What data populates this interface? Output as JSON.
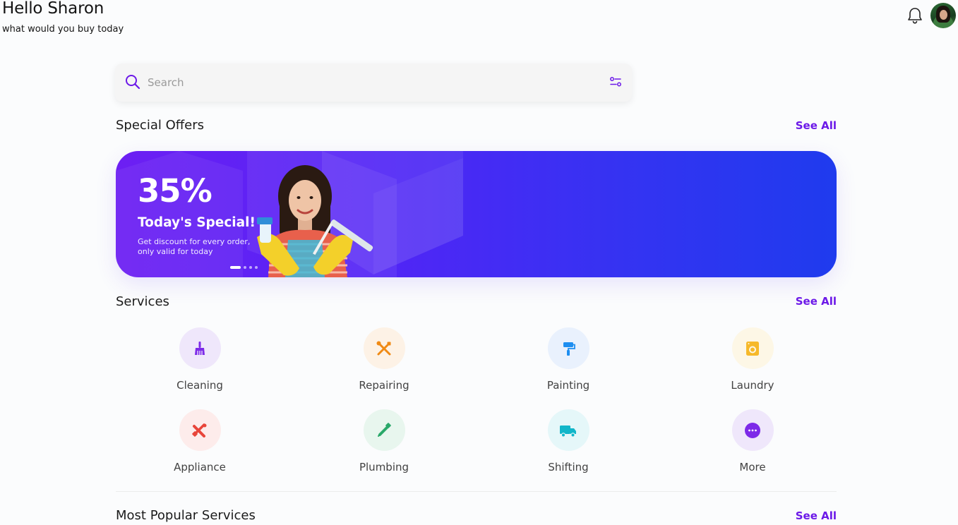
{
  "header": {
    "greeting": "Hello Sharon",
    "subtitle": "what would you buy today"
  },
  "icons": {
    "notification": "bell-icon",
    "profile": "avatar",
    "search": "search-icon",
    "filter": "filter-icon"
  },
  "search": {
    "placeholder": "Search",
    "value": ""
  },
  "special_offers": {
    "title": "Special Offers",
    "see_all": "See All",
    "banner": {
      "percent": "35%",
      "headline": "Today's Special!",
      "description": "Get discount for every order, only valid for today",
      "slides": 4,
      "active_slide": 1
    }
  },
  "services": {
    "title": "Services",
    "see_all": "See All",
    "items": [
      {
        "label": "Cleaning",
        "icon": "broom-icon",
        "color": "#7d2ae8",
        "bg": "#efe7fb"
      },
      {
        "label": "Repairing",
        "icon": "tools-icon",
        "color": "#f08a14",
        "bg": "#fdf2e6"
      },
      {
        "label": "Painting",
        "icon": "paint-roller-icon",
        "color": "#1e8ef0",
        "bg": "#e9f1fd"
      },
      {
        "label": "Laundry",
        "icon": "washing-machine-icon",
        "color": "#f6b92a",
        "bg": "#fdf7e6"
      },
      {
        "label": "Appliance",
        "icon": "appliance-icon",
        "color": "#e8453a",
        "bg": "#fdeceb"
      },
      {
        "label": "Plumbing",
        "icon": "plumbing-icon",
        "color": "#2aa86a",
        "bg": "#e8f6ee"
      },
      {
        "label": "Shifting",
        "icon": "truck-icon",
        "color": "#12b6c9",
        "bg": "#e5f7f9"
      },
      {
        "label": "More",
        "icon": "more-icon",
        "color": "#7d2ae8",
        "bg": "#efe7fb"
      }
    ]
  },
  "popular": {
    "title": "Most Popular Services",
    "see_all": "See All"
  },
  "colors": {
    "accent": "#6c19e8",
    "banner_start": "#6d1ff3",
    "banner_end": "#1f3bee"
  }
}
